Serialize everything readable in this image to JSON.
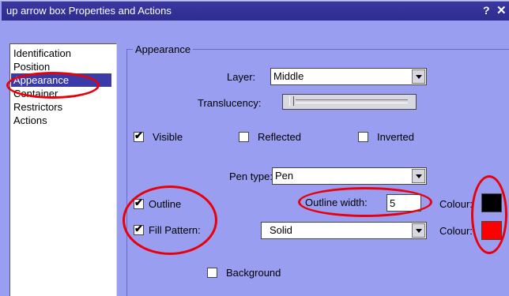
{
  "window": {
    "title": "up arrow box Properties and Actions",
    "help_glyph": "?",
    "close_glyph": "✕"
  },
  "nav": {
    "items": [
      {
        "label": "Identification",
        "selected": false
      },
      {
        "label": "Position",
        "selected": false
      },
      {
        "label": "Appearance",
        "selected": true
      },
      {
        "label": "Container",
        "selected": false
      },
      {
        "label": "Restrictors",
        "selected": false
      },
      {
        "label": "Actions",
        "selected": false
      }
    ]
  },
  "appearance": {
    "caption": "Appearance",
    "layer_label": "Layer:",
    "layer_value": "Middle",
    "translucency_label": "Translucency:",
    "translucency_level": 0,
    "visible_label": "Visible",
    "visible_checked": true,
    "reflected_label": "Reflected",
    "reflected_checked": false,
    "inverted_label": "Inverted",
    "inverted_checked": false,
    "pen_type_label": "Pen type:",
    "pen_type_value": "Pen",
    "outline_label": "Outline",
    "outline_checked": true,
    "outline_width_label": "Outline width:",
    "outline_width_value": "5",
    "outline_colour_label": "Colour:",
    "outline_colour": "#000000",
    "fill_pattern_label": "Fill Pattern:",
    "fill_pattern_checked": true,
    "fill_pattern_value": "Solid",
    "fill_colour_label": "Colour:",
    "fill_colour": "#ff0000",
    "background_label": "Background",
    "background_checked": false
  },
  "check_glyph": "✔",
  "colors": {
    "panel": "#9a9ef0",
    "titlebar": "#2e2c8e",
    "selection": "#3a3aa8",
    "annotation": "#e8000a"
  }
}
